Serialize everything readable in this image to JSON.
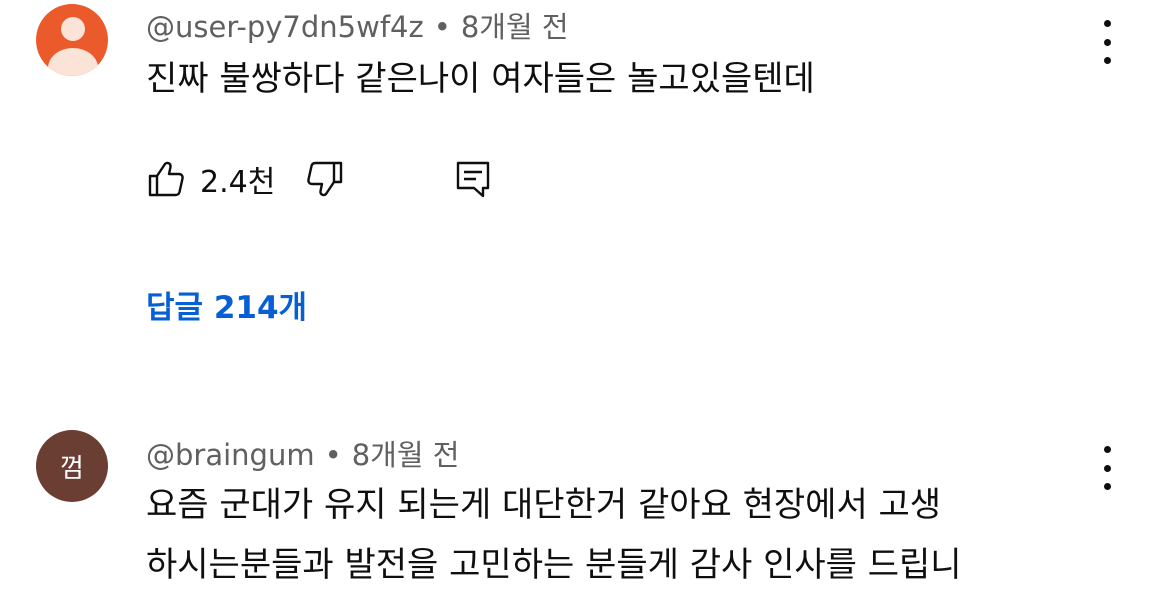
{
  "comments": [
    {
      "author": "@user-py7dn5wf4z",
      "time": "8개월 전",
      "text": "진짜 불쌍하다 같은나이 여자들은 놀고있을텐데",
      "like_count": "2.4천",
      "replies_label": "답글 214개",
      "avatar_icon": "default-user-icon",
      "avatar_color": "#ea5a2a"
    },
    {
      "author": "@braingum",
      "time": "8개월 전",
      "avatar_letter": "껌",
      "avatar_color": "#6b3e33",
      "text_lines": [
        "요즘 군대가 유지 되는게 대단한거 같아요 현장에서 고생",
        "하시는분들과 발전을 고민하는 분들게 감사 인사를 드립니"
      ]
    }
  ],
  "meta_separator": "•",
  "colors": {
    "link": "#065fd4",
    "meta_text": "#606060",
    "primary_text": "#0f0f0f"
  }
}
